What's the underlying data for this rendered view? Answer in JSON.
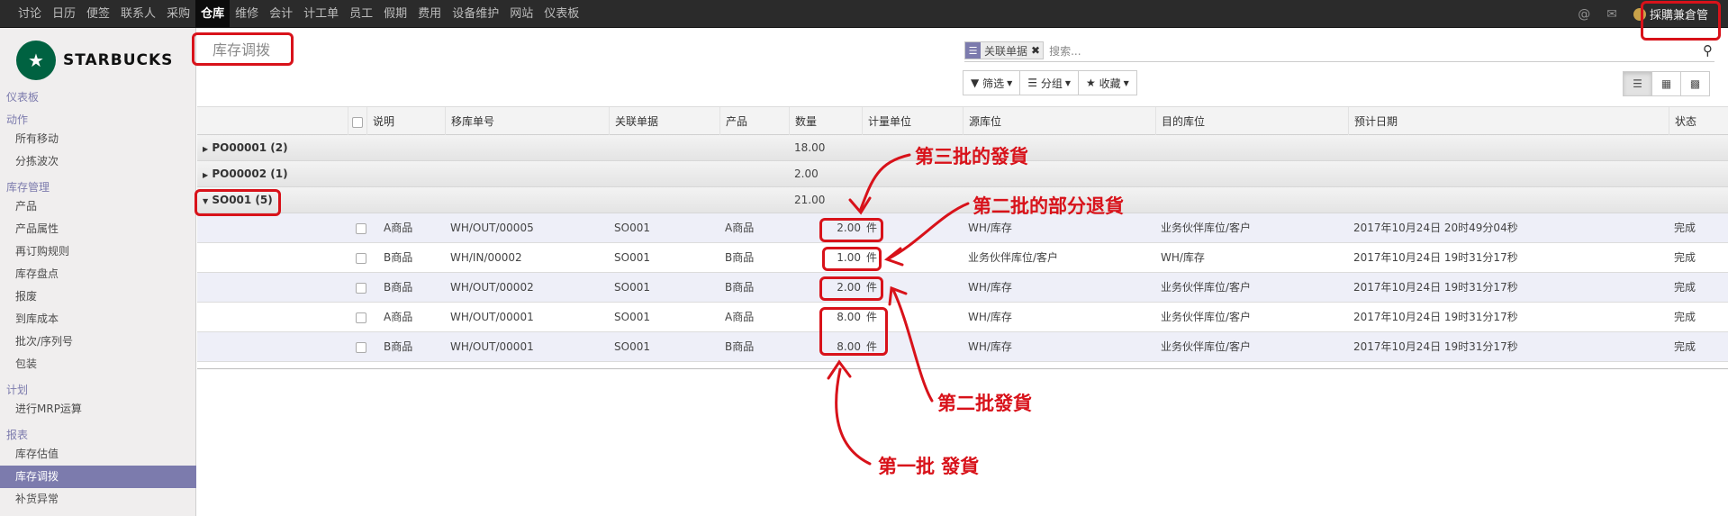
{
  "topbar": {
    "menu": [
      "讨论",
      "日历",
      "便签",
      "联系人",
      "采购",
      "仓库",
      "维修",
      "会计",
      "计工单",
      "员工",
      "假期",
      "费用",
      "设备维护",
      "网站",
      "仪表板"
    ],
    "active_index": 5,
    "user_name": "採購兼倉管",
    "icons": [
      "at-icon",
      "chat-icon"
    ]
  },
  "sidebar": {
    "logo_text": "STARBUCKS",
    "sections": [
      {
        "type": "head",
        "label": "仪表板"
      },
      {
        "type": "head",
        "label": "动作"
      },
      {
        "type": "item",
        "label": "所有移动"
      },
      {
        "type": "item",
        "label": "分拣波次"
      },
      {
        "type": "head",
        "label": "库存管理"
      },
      {
        "type": "item",
        "label": "产品"
      },
      {
        "type": "item",
        "label": "产品属性"
      },
      {
        "type": "item",
        "label": "再订购规则"
      },
      {
        "type": "item",
        "label": "库存盘点"
      },
      {
        "type": "item",
        "label": "报废"
      },
      {
        "type": "item",
        "label": "到库成本"
      },
      {
        "type": "item",
        "label": "批次/序列号"
      },
      {
        "type": "item",
        "label": "包装"
      },
      {
        "type": "head",
        "label": "计划"
      },
      {
        "type": "item",
        "label": "进行MRP运算"
      },
      {
        "type": "head",
        "label": "报表"
      },
      {
        "type": "item",
        "label": "库存估值"
      },
      {
        "type": "item",
        "label": "库存调拨",
        "active": true
      },
      {
        "type": "item",
        "label": "补货异常"
      }
    ]
  },
  "page": {
    "title": "库存调拨",
    "search": {
      "facet": "关联单据",
      "placeholder": "搜索..."
    },
    "buttons": {
      "filter": "筛选",
      "group": "分组",
      "favorite": "收藏"
    }
  },
  "table": {
    "headers": [
      "说明",
      "移库单号",
      "关联单据",
      "产品",
      "数量",
      "计量单位",
      "源库位",
      "目的库位",
      "预计日期",
      "状态"
    ],
    "groups": [
      {
        "label": "PO00001 (2)",
        "qty": "18.00",
        "expanded": false
      },
      {
        "label": "PO00002 (1)",
        "qty": "2.00",
        "expanded": false
      },
      {
        "label": "SO001 (5)",
        "qty": "21.00",
        "expanded": true
      }
    ],
    "rows": [
      {
        "desc": "A商品",
        "ref": "WH/OUT/00005",
        "origin": "SO001",
        "product": "A商品",
        "qty": "2.00",
        "uom": "件",
        "src": "WH/库存",
        "dest": "业务伙伴库位/客户",
        "date": "2017年10月24日 20时49分04秒",
        "state": "完成"
      },
      {
        "desc": "B商品",
        "ref": "WH/IN/00002",
        "origin": "SO001",
        "product": "B商品",
        "qty": "1.00",
        "uom": "件",
        "src": "业务伙伴库位/客户",
        "dest": "WH/库存",
        "date": "2017年10月24日 19时31分17秒",
        "state": "完成"
      },
      {
        "desc": "B商品",
        "ref": "WH/OUT/00002",
        "origin": "SO001",
        "product": "B商品",
        "qty": "2.00",
        "uom": "件",
        "src": "WH/库存",
        "dest": "业务伙伴库位/客户",
        "date": "2017年10月24日 19时31分17秒",
        "state": "完成"
      },
      {
        "desc": "A商品",
        "ref": "WH/OUT/00001",
        "origin": "SO001",
        "product": "A商品",
        "qty": "8.00",
        "uom": "件",
        "src": "WH/库存",
        "dest": "业务伙伴库位/客户",
        "date": "2017年10月24日 19时31分17秒",
        "state": "完成"
      },
      {
        "desc": "B商品",
        "ref": "WH/OUT/00001",
        "origin": "SO001",
        "product": "B商品",
        "qty": "8.00",
        "uom": "件",
        "src": "WH/库存",
        "dest": "业务伙伴库位/客户",
        "date": "2017年10月24日 19时31分17秒",
        "state": "完成"
      }
    ]
  },
  "annotations": {
    "third_batch": "第三批的發貨",
    "partial_return": "第二批的部分退貨",
    "second_batch": "第二批發貨",
    "first_batch": "第一批 發貨"
  },
  "colors": {
    "annotation_red": "#d8121a",
    "accent": "#7c7bad",
    "topbar": "#2b2b2b"
  }
}
